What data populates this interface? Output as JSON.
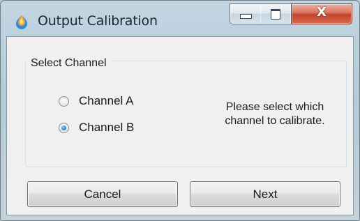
{
  "window": {
    "title": "Output Calibration",
    "icon": "app-icon",
    "close_glyph": "X"
  },
  "group": {
    "label": "Select Channel",
    "options": [
      {
        "label": "Channel A",
        "selected": false
      },
      {
        "label": "Channel B",
        "selected": true
      }
    ]
  },
  "hint": {
    "line1": "Please select which",
    "line2": "channel to calibrate."
  },
  "buttons": {
    "cancel": "Cancel",
    "next": "Next"
  },
  "colors": {
    "close_button": "#c2432a",
    "radio_selected": "#2a83c4",
    "dialog_background": "#f0f0f0"
  }
}
